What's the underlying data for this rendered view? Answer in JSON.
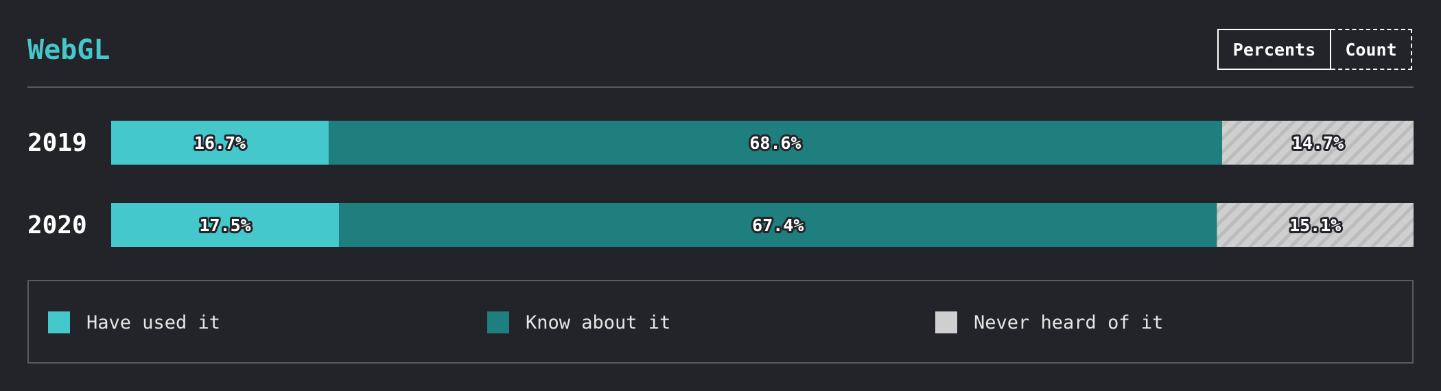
{
  "header": {
    "title": "WebGL"
  },
  "toggle": {
    "percents_label": "Percents",
    "count_label": "Count",
    "active": "Percents"
  },
  "colors": {
    "background": "#232429",
    "accent": "#45c8cb",
    "have_used": "#45c8cb",
    "know_about": "#1f7e7e",
    "never_heard": "#cfcfcf"
  },
  "chart_data": {
    "type": "bar",
    "orientation": "horizontal",
    "stacked": true,
    "normalized": true,
    "categories": [
      "2019",
      "2020"
    ],
    "series": [
      {
        "name": "Have used it",
        "values": [
          16.7,
          17.5
        ],
        "labels": [
          "16.7%",
          "17.5%"
        ],
        "color": "#45c8cb"
      },
      {
        "name": "Know about it",
        "values": [
          68.6,
          67.4
        ],
        "labels": [
          "68.6%",
          "67.4%"
        ],
        "color": "#1f7e7e"
      },
      {
        "name": "Never heard of it",
        "values": [
          14.7,
          15.1
        ],
        "labels": [
          "14.7%",
          "15.1%"
        ],
        "color": "#cfcfcf",
        "pattern": "diagonal-stripes"
      }
    ],
    "xlim": [
      0,
      100
    ],
    "legend_position": "bottom",
    "grid": false
  },
  "legend": {
    "items": [
      {
        "label": "Have used it",
        "color": "#45c8cb"
      },
      {
        "label": "Know about it",
        "color": "#1f7e7e"
      },
      {
        "label": "Never heard of it",
        "color": "#cfcfcf"
      }
    ]
  }
}
